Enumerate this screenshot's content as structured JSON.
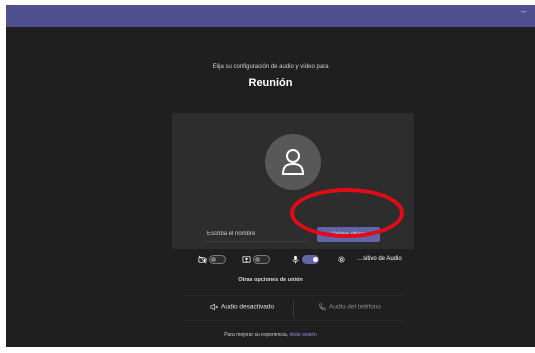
{
  "header": {
    "subtitle": "Elija su configuración de audio y vídeo para",
    "title": "Reunión"
  },
  "join": {
    "name_placeholder": "Escriba el nombre",
    "join_label": "Unirse ahora"
  },
  "devices": {
    "audio_label": "…sitivo de Audio",
    "camera_toggle_on": false,
    "blur_toggle_on": false,
    "mic_toggle_on": true
  },
  "other_options": {
    "title": "Otras opciones de unión",
    "audio_off_label": "Audio desactivado",
    "phone_audio_label": "Audio del teléfono"
  },
  "footer": {
    "text": "Para mejorar su experiencia,",
    "link": "inicie sesión"
  },
  "colors": {
    "titlebar": "#4f4f8f",
    "background": "#1f1f1f",
    "accent": "#6264a7",
    "highlight_ring": "#e10a17",
    "link": "#8f92e6"
  }
}
